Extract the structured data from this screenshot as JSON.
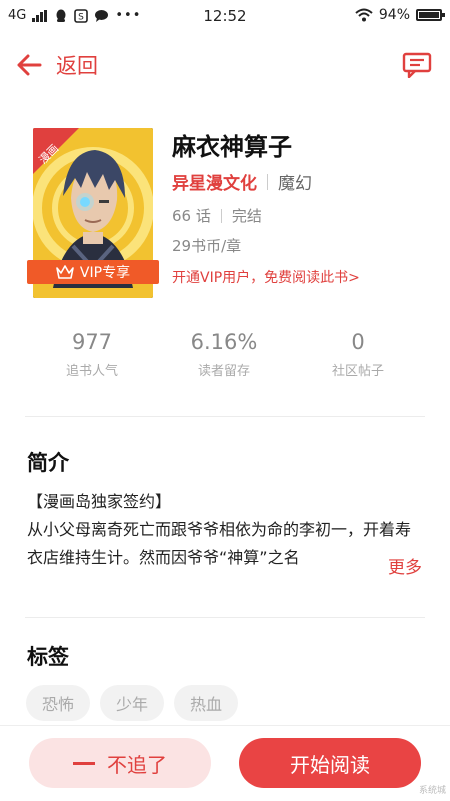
{
  "statusbar": {
    "network": "4G",
    "time": "12:52",
    "battery": "94%"
  },
  "nav": {
    "back_label": "返回"
  },
  "book": {
    "cover_tag": "漫画",
    "vip_badge": "VIP专享",
    "title": "麻衣神算子",
    "author": "异星漫文化",
    "genre": "魔幻",
    "chapters": "66 话",
    "status": "完结",
    "price": "29书币/章",
    "vip_link": "开通VIP用户，免费阅读此书>"
  },
  "stats": [
    {
      "value": "977",
      "label": "追书人气"
    },
    {
      "value": "6.16%",
      "label": "读者留存"
    },
    {
      "value": "0",
      "label": "社区帖子"
    }
  ],
  "intro": {
    "title": "简介",
    "text": "【漫画岛独家签约】\n从小父母离奇死亡而跟爷爷相依为命的李初一，开着寿衣店维持生计。然而因爷爷“神算”之名",
    "more_label": "更多"
  },
  "tags": {
    "title": "标签",
    "items": [
      "恐怖",
      "少年",
      "热血"
    ]
  },
  "actions": {
    "unfollow_label": "不追了",
    "read_label": "开始阅读"
  },
  "watermark": "系统城"
}
